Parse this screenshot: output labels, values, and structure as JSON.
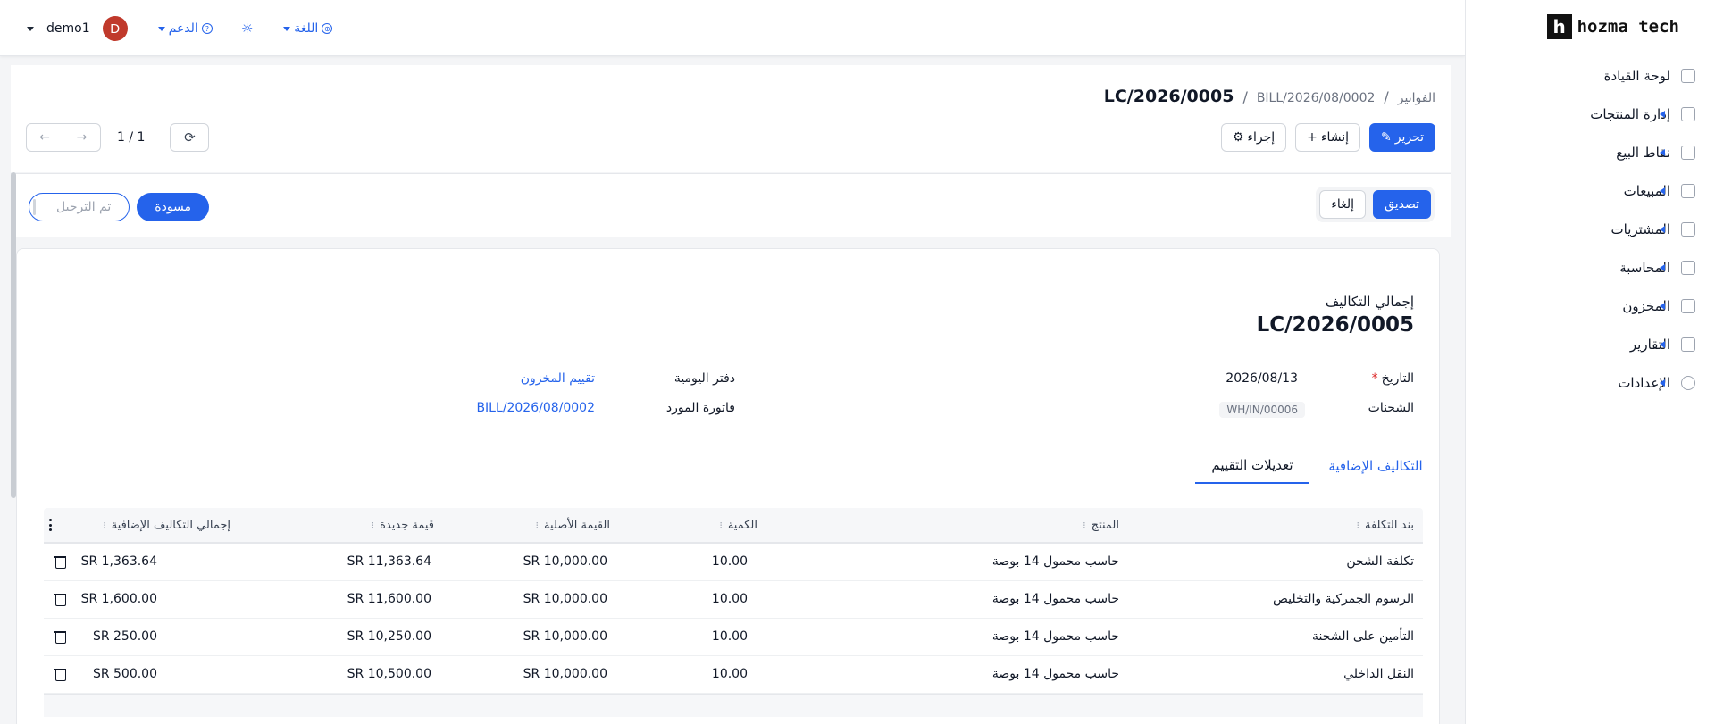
{
  "header": {
    "username": "demo1",
    "avatar_letter": "D",
    "support_label": "الدعم",
    "language_label": "اللغة"
  },
  "brand": {
    "logo_letter": "h",
    "name": "hozma tech"
  },
  "sidebar": {
    "items": [
      {
        "label": "لوحة القيادة",
        "icon": "dashboard-icon",
        "expandable": false
      },
      {
        "label": "إدارة المنتجات",
        "icon": "tag-icon",
        "expandable": true
      },
      {
        "label": "نقاط البيع",
        "icon": "store-icon",
        "expandable": true
      },
      {
        "label": "المبيعات",
        "icon": "chart-line-icon",
        "expandable": true
      },
      {
        "label": "المشتريات",
        "icon": "wallet-icon",
        "expandable": true
      },
      {
        "label": "المحاسبة",
        "icon": "ledger-icon",
        "expandable": true
      },
      {
        "label": "المخزون",
        "icon": "box-icon",
        "expandable": true
      },
      {
        "label": "التقارير",
        "icon": "report-icon",
        "expandable": true
      },
      {
        "label": "الإعدادات",
        "icon": "gear-icon",
        "expandable": true
      }
    ]
  },
  "breadcrumb": {
    "root": "الفواتير",
    "middle": "BILL/2026/08/0002",
    "current": "LC/2026/0005"
  },
  "toolbar": {
    "edit_label": "تحرير",
    "create_label": "إنشاء",
    "action_label": "إجراء",
    "pager_count": "1 / 1"
  },
  "status": {
    "validate_label": "تصديق",
    "cancel_label": "إلغاء",
    "steps": [
      {
        "label": "تم الترحيل",
        "state": "done"
      },
      {
        "label": "مسودة",
        "state": "active"
      }
    ]
  },
  "document": {
    "subtitle": "إجمالي التكاليف",
    "title": "LC/2026/0005",
    "date_label": "التاريخ",
    "date_value": "2026/08/13",
    "shipments_label": "الشحنات",
    "shipments_value": "WH/IN/00006",
    "journal_label": "دفتر اليومية",
    "journal_value": "تقييم المخزون",
    "vendor_bill_label": "فاتورة المورد",
    "vendor_bill_value": "BILL/2026/08/0002"
  },
  "tabs": [
    {
      "label": "التكاليف الإضافية",
      "active": false
    },
    {
      "label": "تعديلات التقييم",
      "active": true
    }
  ],
  "table": {
    "columns": [
      "بند التكلفة",
      "المنتج",
      "الكمية",
      "القيمة الأصلية",
      "قيمة جديدة",
      "إجمالي التكاليف الإضافية"
    ],
    "rows": [
      [
        "تكلفة الشحن",
        "حاسب محمول 14 بوصة",
        "10.00",
        "SR 10,000.00",
        "SR 11,363.64",
        "SR 1,363.64"
      ],
      [
        "الرسوم الجمركية والتخليص",
        "حاسب محمول 14 بوصة",
        "10.00",
        "SR 10,000.00",
        "SR 11,600.00",
        "SR 1,600.00"
      ],
      [
        "التأمين على الشحنة",
        "حاسب محمول 14 بوصة",
        "10.00",
        "SR 10,000.00",
        "SR 10,250.00",
        "SR 250.00"
      ],
      [
        "النقل الداخلي",
        "حاسب محمول 14 بوصة",
        "10.00",
        "SR 10,000.00",
        "SR 10,500.00",
        "SR 500.00"
      ]
    ]
  },
  "colors": {
    "accent": "#2563eb",
    "avatar": "#c0392b",
    "required": "#dc2626"
  }
}
